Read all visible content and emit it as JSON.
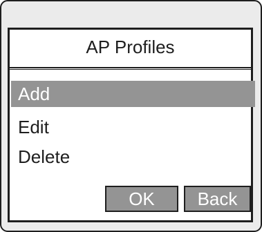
{
  "screen": {
    "title": "AP Profiles"
  },
  "menu": {
    "items": [
      {
        "label": "Add",
        "selected": true
      },
      {
        "label": "Edit",
        "selected": false
      },
      {
        "label": "Delete",
        "selected": false
      }
    ]
  },
  "buttons": {
    "ok_label": "OK",
    "back_label": "Back"
  },
  "colors": {
    "highlight": "#949494",
    "text": "#1e1e1e",
    "screen_bg": "#ffffff",
    "bezel_bg": "#ebebeb"
  }
}
